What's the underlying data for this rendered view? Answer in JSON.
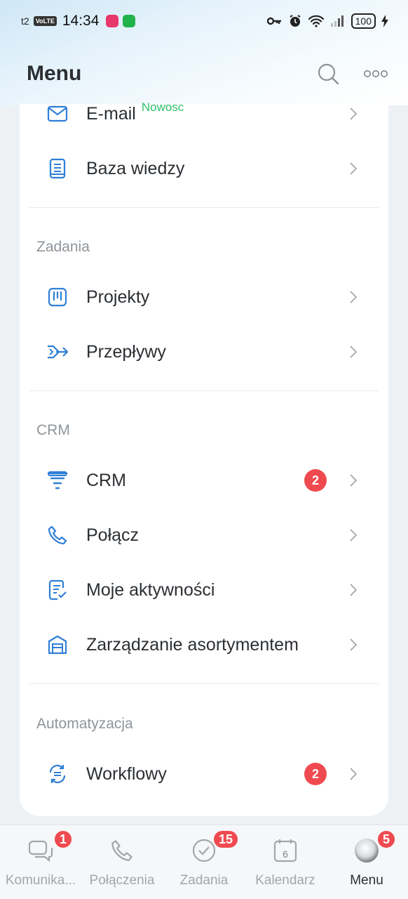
{
  "status_bar": {
    "carrier": "t2",
    "volte": "VoLTE",
    "time": "14:34",
    "battery": "100"
  },
  "header": {
    "title": "Menu"
  },
  "menu": {
    "email": {
      "label": "E-mail",
      "tag": "Nowosc"
    },
    "knowledge": {
      "label": "Baza wiedzy"
    },
    "section_tasks": "Zadania",
    "projects": {
      "label": "Projekty"
    },
    "flows": {
      "label": "Przepływy"
    },
    "section_crm": "CRM",
    "crm": {
      "label": "CRM",
      "badge": "2"
    },
    "connect": {
      "label": "Połącz"
    },
    "activities": {
      "label": "Moje aktywności"
    },
    "inventory": {
      "label": "Zarządzanie asortymentem"
    },
    "section_automation": "Automatyzacja",
    "workflows": {
      "label": "Workflowy",
      "badge": "2"
    }
  },
  "bottom_nav": {
    "items": [
      {
        "label": "Komunika...",
        "badge": "1",
        "icon": "chat-icon"
      },
      {
        "label": "Połączenia",
        "icon": "phone-icon"
      },
      {
        "label": "Zadania",
        "badge": "15",
        "icon": "check-circle-icon"
      },
      {
        "label": "Kalendarz",
        "day": "6",
        "icon": "calendar-icon"
      },
      {
        "label": "Menu",
        "badge": "5",
        "icon": "avatar",
        "active": true
      }
    ]
  },
  "colors": {
    "accent_blue": "#2f7fd6",
    "badge_red": "#ef4a50",
    "new_green": "#2fc26b"
  }
}
